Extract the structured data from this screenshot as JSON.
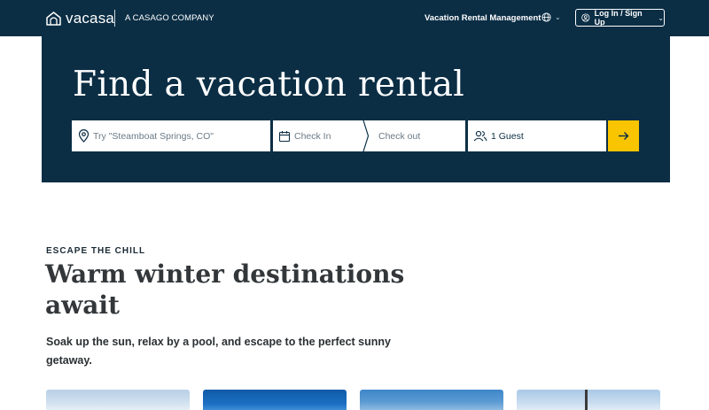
{
  "header": {
    "logo_text": "vacasa",
    "tagline": "A CASAGO COMPANY",
    "nav_link": "Vacation Rental Management",
    "language_icon": "globe-icon",
    "login_label": "Log In / Sign Up"
  },
  "hero": {
    "title": "Find a vacation rental",
    "search": {
      "location_placeholder": "Try \"Steamboat Springs, CO\"",
      "check_in_placeholder": "Check In",
      "check_out_placeholder": "Check out",
      "guests_value": "1 Guest",
      "submit_icon": "arrow-right-icon"
    }
  },
  "section": {
    "eyebrow": "ESCAPE THE CHILL",
    "title": "Warm winter destinations await",
    "subtitle": "Soak up the sun, relax by a pool, and escape to the perfect sunny getaway."
  },
  "colors": {
    "navy": "#0b2e45",
    "accent_yellow": "#f9c500",
    "white": "#ffffff"
  }
}
